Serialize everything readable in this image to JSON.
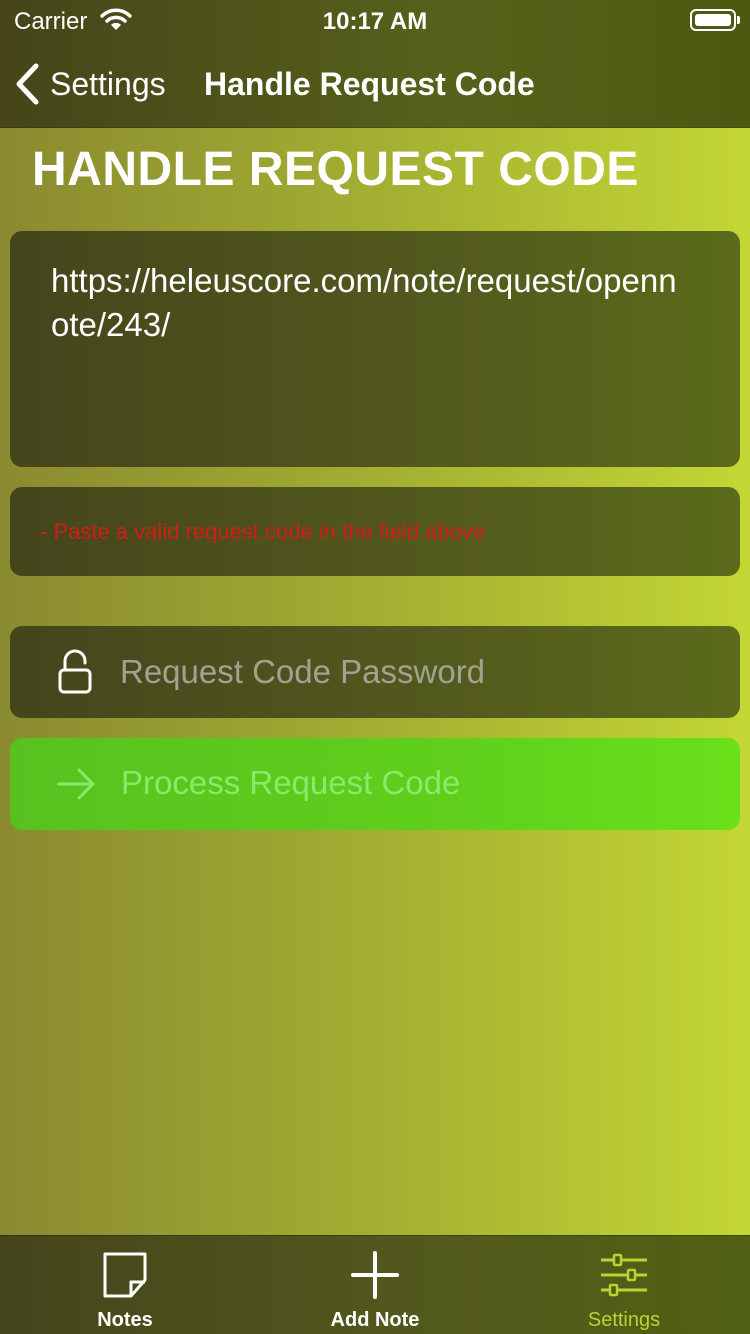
{
  "status_bar": {
    "carrier": "Carrier",
    "time": "10:17 AM",
    "icons": [
      "wifi-icon",
      "battery-icon"
    ]
  },
  "nav": {
    "back_label": "Settings",
    "title": "Handle Request Code"
  },
  "page": {
    "heading": "HANDLE REQUEST CODE",
    "request_code_value": "https://heleuscore.com/note/request/opennote/243/",
    "error_message": "- Paste a valid request code in the field above",
    "password_placeholder": "Request Code Password",
    "process_button_label": "Process Request Code"
  },
  "tab_bar": {
    "tabs": [
      {
        "label": "Notes",
        "icon": "note-icon"
      },
      {
        "label": "Add Note",
        "icon": "plus-icon"
      },
      {
        "label": "Settings",
        "icon": "sliders-icon",
        "selected": true
      }
    ]
  },
  "colors": {
    "error": "#d41c17",
    "accent_green": "#5fcf1c",
    "selected_tab": "#b7d532"
  }
}
